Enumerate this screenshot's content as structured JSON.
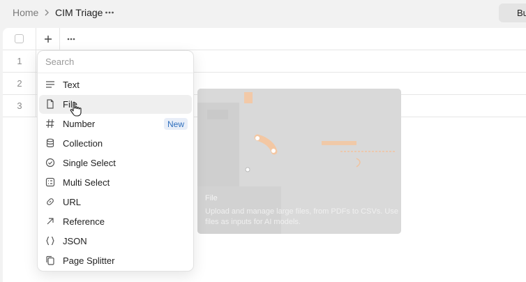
{
  "breadcrumb": {
    "home": "Home",
    "current": "CIM Triage"
  },
  "top_button": {
    "label": "Bu"
  },
  "table": {
    "rows": [
      "1",
      "2",
      "3"
    ]
  },
  "menu": {
    "search_placeholder": "Search",
    "items": [
      {
        "label": "Text",
        "icon": "text-lines-icon"
      },
      {
        "label": "File",
        "icon": "file-icon",
        "active": true
      },
      {
        "label": "Number",
        "icon": "hash-icon",
        "badge": "New"
      },
      {
        "label": "Collection",
        "icon": "database-icon"
      },
      {
        "label": "Single Select",
        "icon": "check-circle-icon"
      },
      {
        "label": "Multi Select",
        "icon": "checklist-icon"
      },
      {
        "label": "URL",
        "icon": "link-icon"
      },
      {
        "label": "Reference",
        "icon": "arrow-up-right-icon"
      },
      {
        "label": "JSON",
        "icon": "braces-icon"
      },
      {
        "label": "Page Splitter",
        "icon": "copy-pages-icon"
      }
    ]
  },
  "preview": {
    "title": "File",
    "description": "Upload and manage large files, from PDFs to CSVs. Use files as inputs for AI models."
  },
  "colors": {
    "badge_bg": "#e8eef8",
    "badge_text": "#2f6fbd",
    "active_item": "#efefef"
  }
}
